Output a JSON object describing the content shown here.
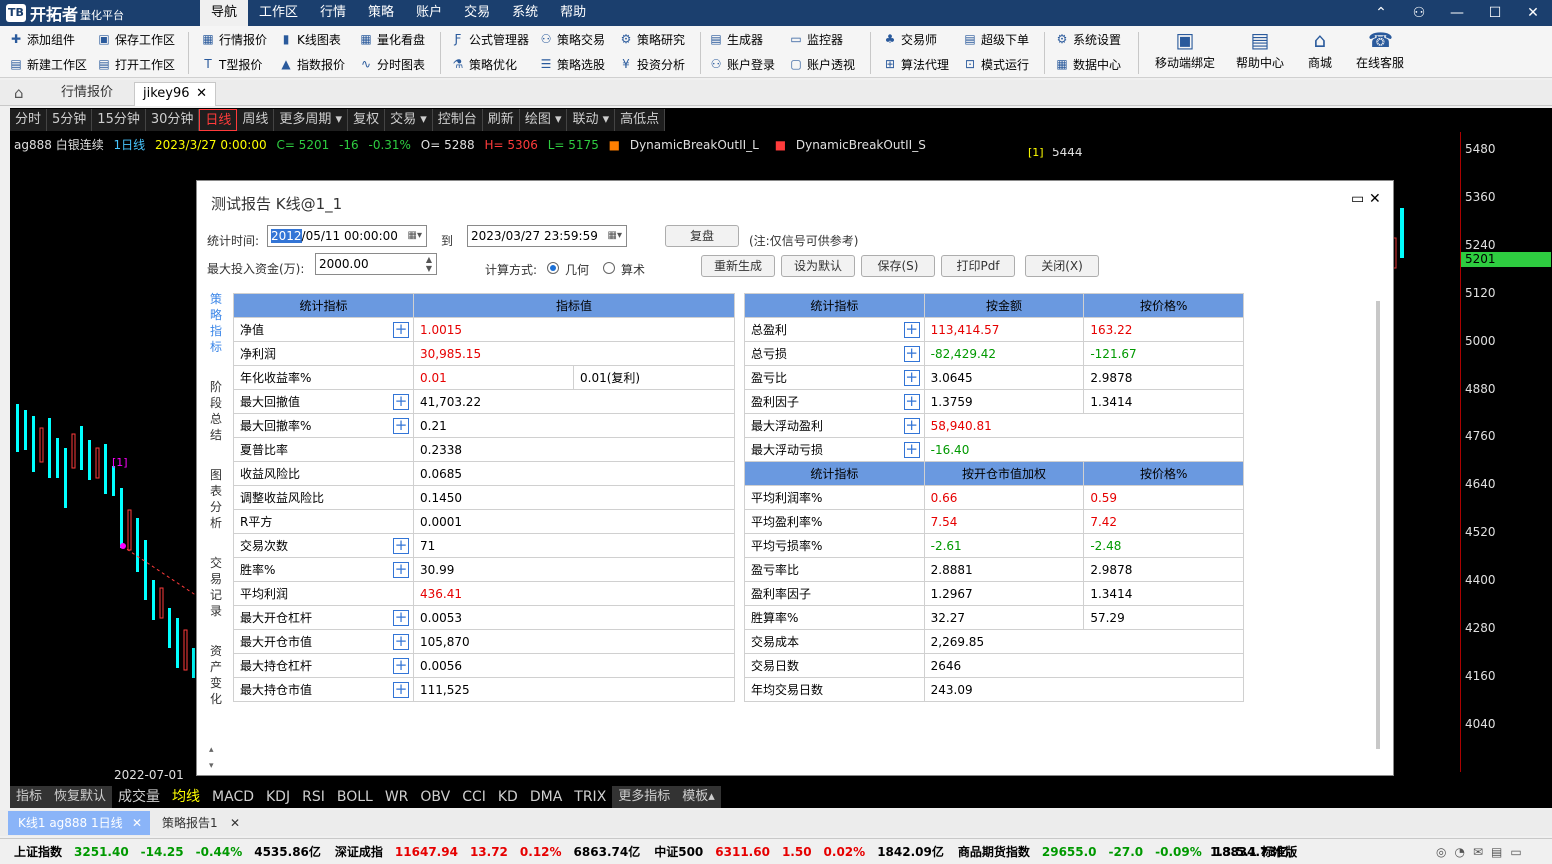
{
  "app": {
    "logo_mark": "TB",
    "name": "开拓者",
    "subtitle": "量化平台"
  },
  "menu": [
    "导航",
    "工作区",
    "行情",
    "策略",
    "账户",
    "交易",
    "系统",
    "帮助"
  ],
  "toolbar": {
    "items": [
      "添加组件",
      "新建工作区",
      "保存工作区",
      "打开工作区",
      "行情报价",
      "T型报价",
      "K线图表",
      "指数报价",
      "量化看盘",
      "分时图表",
      "公式管理器",
      "策略优化",
      "策略交易",
      "策略选股",
      "策略研究",
      "投资分析",
      "生成器",
      "账户登录",
      "监控器",
      "账户透视",
      "交易师",
      "算法代理",
      "超级下单",
      "模式运行",
      "系统设置",
      "数据中心"
    ],
    "big": [
      "移动端绑定",
      "帮助中心",
      "商城",
      "在线客服"
    ]
  },
  "tabs": {
    "tab1": "行情报价",
    "tab2": "jikey96"
  },
  "periods": [
    "分时",
    "5分钟",
    "15分钟",
    "30分钟",
    "日线",
    "周线",
    "更多周期 ▾",
    "复权",
    "交易 ▾",
    "控制台",
    "刷新",
    "绘图 ▾",
    "联动 ▾",
    "高低点"
  ],
  "quote": {
    "symbol": "ag888 白银连续",
    "period": "1日线",
    "date": "2023/3/27 0:00:00",
    "c": "C= 5201",
    "chg": "-16",
    "pct": "-0.31%",
    "o": "O= 5288",
    "h": "H= 5306",
    "l": "L= 5175",
    "ind1": "DynamicBreakOutII_L",
    "ind2": "DynamicBreakOutII_S"
  },
  "chart_labels": {
    "marker_top": "[1]",
    "marker_top_price": "5444",
    "marker_left": "[1]",
    "date": "2022-07-01"
  },
  "price_axis": [
    "5480",
    "5360",
    "5240",
    "5120",
    "5000",
    "4880",
    "4760",
    "4640",
    "4520",
    "4400",
    "4280",
    "4160",
    "4040"
  ],
  "current_price": "5201",
  "indicators": [
    "指标",
    "恢复默认",
    "成交量",
    "均线",
    "MACD",
    "KDJ",
    "RSI",
    "BOLL",
    "WR",
    "OBV",
    "CCI",
    "KD",
    "DMA",
    "TRIX",
    "更多指标",
    "模板▴"
  ],
  "bottom_tabs": {
    "t1": "K线1 ag888 1日线",
    "t2": "策略报告1"
  },
  "status": [
    {
      "name": "上证指数",
      "price": "3251.40",
      "chg": "-14.25",
      "pct": "-0.44%",
      "amt": "4535.86亿"
    },
    {
      "name": "深证成指",
      "price": "11647.94",
      "chg": "13.72",
      "pct": "0.12%",
      "amt": "6863.74亿"
    },
    {
      "name": "中证500",
      "price": "6311.60",
      "chg": "1.50",
      "pct": "0.02%",
      "amt": "1842.09亿"
    },
    {
      "name": "商品期货指数",
      "price": "29655.0",
      "chg": "-27.0",
      "pct": "-0.09%",
      "amt": "18834.73亿"
    }
  ],
  "version": "1.3.5.1 标准版",
  "dialog": {
    "title": "测试报告 K线@1_1",
    "stat_time_label": "统计时间:",
    "start_sel": "2012",
    "start_rest": "/05/11 00:00:00",
    "to_label": "到",
    "end": "2023/03/27 23:59:59",
    "replay_btn": "复盘",
    "note": "(注:仅信号可供参考)",
    "capital_label": "最大投入资金(万):",
    "capital": "2000.00",
    "calc_label": "计算方式:",
    "calc_geo": "几何",
    "calc_arith": "算术",
    "buttons": [
      "重新生成",
      "设为默认",
      "保存(S)",
      "打印Pdf",
      "关闭(X)"
    ],
    "side_tabs": [
      "策略指标",
      "阶段总结",
      "图表分析",
      "交易记录",
      "资产变化"
    ]
  },
  "table_left": {
    "headers": [
      "统计指标",
      "指标值"
    ],
    "rows": [
      {
        "name": "净值",
        "value": "1.0015",
        "plus": true,
        "color": "red"
      },
      {
        "name": "净利润",
        "value": "30,985.15",
        "plus": false,
        "color": "red"
      },
      {
        "name": "年化收益率%",
        "value": "0.01",
        "extra": "0.01(复利)",
        "plus": false,
        "color": "red"
      },
      {
        "name": "最大回撤值",
        "value": "41,703.22",
        "plus": true,
        "color": ""
      },
      {
        "name": "最大回撤率%",
        "value": "0.21",
        "plus": true,
        "color": ""
      },
      {
        "name": "夏普比率",
        "value": "0.2338",
        "plus": false,
        "color": ""
      },
      {
        "name": "收益风险比",
        "value": "0.0685",
        "plus": false,
        "color": ""
      },
      {
        "name": "调整收益风险比",
        "value": "0.1450",
        "plus": false,
        "color": ""
      },
      {
        "name": "R平方",
        "value": "0.0001",
        "plus": false,
        "color": ""
      },
      {
        "name": "交易次数",
        "value": "71",
        "plus": true,
        "color": ""
      },
      {
        "name": "胜率%",
        "value": "30.99",
        "plus": true,
        "color": ""
      },
      {
        "name": "平均利润",
        "value": "436.41",
        "plus": false,
        "color": "red"
      },
      {
        "name": "最大开仓杠杆",
        "value": "0.0053",
        "plus": true,
        "color": ""
      },
      {
        "name": "最大开仓市值",
        "value": "105,870",
        "plus": true,
        "color": ""
      },
      {
        "name": "最大持仓杠杆",
        "value": "0.0056",
        "plus": true,
        "color": ""
      },
      {
        "name": "最大持仓市值",
        "value": "111,525",
        "plus": true,
        "color": ""
      }
    ]
  },
  "table_right": {
    "headers1": [
      "统计指标",
      "按金额",
      "按价格%"
    ],
    "rows1": [
      {
        "name": "总盈利",
        "v1": "113,414.57",
        "v2": "163.22",
        "plus": true,
        "c1": "red",
        "c2": "red"
      },
      {
        "name": "总亏损",
        "v1": "-82,429.42",
        "v2": "-121.67",
        "plus": true,
        "c1": "green",
        "c2": "green"
      },
      {
        "name": "盈亏比",
        "v1": "3.0645",
        "v2": "2.9878",
        "plus": true,
        "c1": "",
        "c2": ""
      },
      {
        "name": "盈利因子",
        "v1": "1.3759",
        "v2": "1.3414",
        "plus": true,
        "c1": "",
        "c2": ""
      },
      {
        "name": "最大浮动盈利",
        "v1": "58,940.81",
        "v2": "",
        "plus": true,
        "c1": "red",
        "c2": ""
      },
      {
        "name": "最大浮动亏损",
        "v1": "-16.40",
        "v2": "",
        "plus": true,
        "c1": "green",
        "c2": ""
      }
    ],
    "headers2": [
      "统计指标",
      "按开仓市值加权",
      "按价格%"
    ],
    "rows2": [
      {
        "name": "平均利润率%",
        "v1": "0.66",
        "v2": "0.59",
        "c1": "red",
        "c2": "red"
      },
      {
        "name": "平均盈利率%",
        "v1": "7.54",
        "v2": "7.42",
        "c1": "red",
        "c2": "red"
      },
      {
        "name": "平均亏损率%",
        "v1": "-2.61",
        "v2": "-2.48",
        "c1": "green",
        "c2": "green"
      },
      {
        "name": "盈亏率比",
        "v1": "2.8881",
        "v2": "2.9878",
        "c1": "",
        "c2": ""
      },
      {
        "name": "盈利率因子",
        "v1": "1.2967",
        "v2": "1.3414",
        "c1": "",
        "c2": ""
      },
      {
        "name": "胜算率%",
        "v1": "32.27",
        "v2": "57.29",
        "c1": "",
        "c2": ""
      },
      {
        "name": "交易成本",
        "v1": "2,269.85",
        "v2": "",
        "c1": "",
        "c2": ""
      },
      {
        "name": "交易日数",
        "v1": "2646",
        "v2": "",
        "c1": "",
        "c2": ""
      },
      {
        "name": "年均交易日数",
        "v1": "243.09",
        "v2": "",
        "c1": "",
        "c2": ""
      }
    ]
  }
}
